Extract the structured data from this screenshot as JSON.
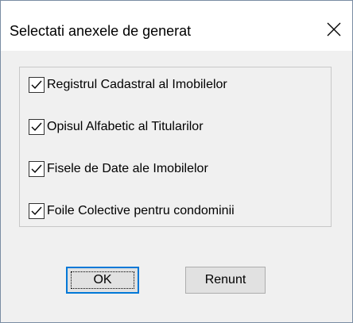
{
  "dialog": {
    "title": "Selectati anexele de generat",
    "close_icon": "close-icon"
  },
  "options": [
    {
      "label": "Registrul Cadastral al Imobilelor",
      "checked": true
    },
    {
      "label": "Opisul Alfabetic al Titularilor",
      "checked": true
    },
    {
      "label": "Fisele de Date ale Imobilelor",
      "checked": true
    },
    {
      "label": "Foile Colective pentru condominii",
      "checked": true
    }
  ],
  "buttons": {
    "ok_label": "OK",
    "cancel_label": "Renunt"
  },
  "colors": {
    "focus_border": "#0078d7",
    "dialog_background": "#f0f0f0",
    "titlebar_background": "#ffffff"
  }
}
